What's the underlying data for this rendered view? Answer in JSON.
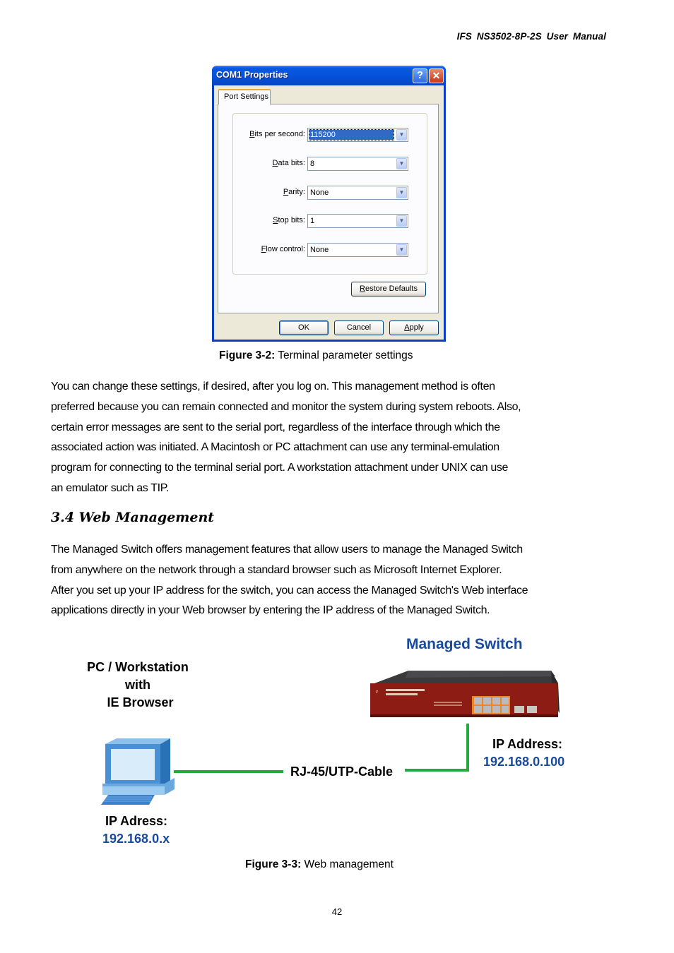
{
  "header": {
    "title": "IFS  NS3502-8P-2S  User  Manual"
  },
  "figure_3_2": {
    "dialog": {
      "title": "COM1 Properties",
      "help_button": "?",
      "close_button": "✕",
      "tab": "Port Settings",
      "fields": [
        {
          "label_underline": "B",
          "label_rest": "its per second:",
          "value": "115200",
          "selected": true
        },
        {
          "label_underline": "D",
          "label_rest": "ata bits:",
          "value": "8"
        },
        {
          "label_underline": "P",
          "label_rest": "arity:",
          "value": "None"
        },
        {
          "label_underline": "S",
          "label_rest": "top bits:",
          "value": "1"
        },
        {
          "label_underline": "F",
          "label_rest": "low control:",
          "value": "None"
        }
      ],
      "restore_defaults_underline": "R",
      "restore_defaults_rest": "estore Defaults",
      "ok_button": "OK",
      "cancel_button": "Cancel",
      "apply_underline": "A",
      "apply_rest": "pply"
    },
    "caption_label": "Figure 3-2:",
    "caption_text": " Terminal parameter settings"
  },
  "paragraph_1": [
    "You can change these settings, if desired, after you log on. This management method is often",
    "preferred because you can remain connected and monitor the system during system reboots. Also,",
    "certain error messages are sent to the serial port, regardless of the interface through which the",
    "associated action was initiated. A Macintosh or PC attachment can use any terminal-emulation",
    "program for connecting to the terminal serial port. A workstation attachment under UNIX can use",
    "an emulator such as TIP."
  ],
  "section": {
    "heading": "3.4 Web Management"
  },
  "paragraph_2": [
    "The Managed Switch offers management features that allow users to manage the Managed Switch",
    "from anywhere on the network through a standard browser such as Microsoft Internet Explorer.",
    "After you set up your IP address for the switch, you can access the Managed Switch's Web interface",
    "applications directly in your Web browser by entering the IP address of the Managed Switch."
  ],
  "figure_3_3": {
    "pc_label": [
      "PC / Workstation",
      "with",
      "IE Browser"
    ],
    "switch_label": "Managed Switch",
    "cable_label": "RJ-45/UTP-Cable",
    "switch_ip_label": "IP Address:",
    "switch_ip": "192.168.0.100",
    "pc_ip_label": "IP Adress:",
    "pc_ip": "192.168.0.x",
    "caption_label": "Figure 3-3:",
    "caption_text": " Web management",
    "colors": {
      "ip_blue": "#1a4a9c",
      "cable_green": "#22aa3c",
      "switch_red": "#8c1c14"
    }
  },
  "footer": {
    "page_number": "42"
  }
}
